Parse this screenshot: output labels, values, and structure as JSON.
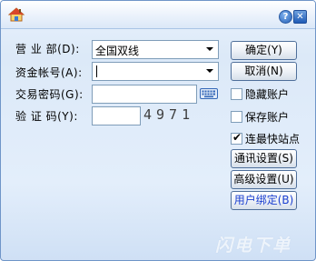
{
  "window": {
    "help_glyph": "?",
    "close_glyph": "✕"
  },
  "form": {
    "branch_label": "营 业 部(D):",
    "branch_value": "全国双线",
    "account_label": "资金帐号(A):",
    "account_value": "",
    "password_label": "交易密码(G):",
    "password_value": "",
    "captcha_label": "验 证 码(Y):",
    "captcha_value": "",
    "captcha_code": "4971"
  },
  "buttons": {
    "confirm": "确定(Y)",
    "cancel": "取消(N)",
    "comm_settings": "通讯设置(S)",
    "advanced_settings": "高级设置(U)",
    "user_binding": "用户绑定(B)"
  },
  "checkboxes": [
    {
      "label": "隐藏账户",
      "checked": false
    },
    {
      "label": "保存账户",
      "checked": false
    },
    {
      "label": "连最快站点",
      "checked": true
    }
  ],
  "watermark": "闪电下单",
  "colors": {
    "accent_blue": "#1a3fd0",
    "border": "#7f9db9"
  }
}
